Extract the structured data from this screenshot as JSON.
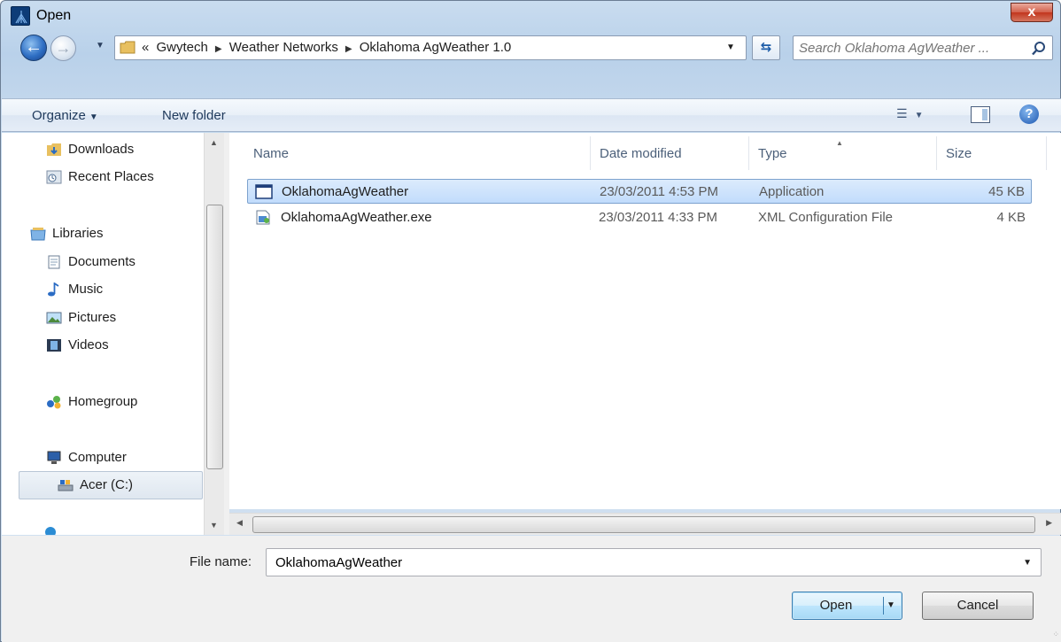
{
  "window": {
    "title": "Open",
    "close_label": "x"
  },
  "navigation": {
    "breadcrumb_prefix": "«",
    "breadcrumbs": [
      "Gwytech",
      "Weather Networks",
      "Oklahoma AgWeather 1.0"
    ],
    "search_placeholder": "Search Oklahoma AgWeather ..."
  },
  "toolbar": {
    "organize_label": "Organize",
    "new_folder_label": "New folder"
  },
  "nav_pane": {
    "items": [
      {
        "label": "Downloads",
        "icon": "downloads-folder-icon"
      },
      {
        "label": "Recent Places",
        "icon": "recent-places-icon"
      },
      {
        "label": "Libraries",
        "icon": "libraries-icon"
      },
      {
        "label": "Documents",
        "icon": "documents-icon"
      },
      {
        "label": "Music",
        "icon": "music-note-icon"
      },
      {
        "label": "Pictures",
        "icon": "pictures-icon"
      },
      {
        "label": "Videos",
        "icon": "film-icon"
      },
      {
        "label": "Homegroup",
        "icon": "homegroup-icon"
      },
      {
        "label": "Computer",
        "icon": "computer-icon"
      },
      {
        "label": "Acer (C:)",
        "icon": "drive-icon"
      }
    ]
  },
  "file_list": {
    "columns": {
      "name": "Name",
      "date_modified": "Date modified",
      "type": "Type",
      "size": "Size"
    },
    "rows": [
      {
        "name": "OklahomaAgWeather",
        "date": "23/03/2011 4:53 PM",
        "type": "Application",
        "size": "45 KB",
        "icon": "application-window-icon"
      },
      {
        "name": "OklahomaAgWeather.exe",
        "date": "23/03/2011 4:33 PM",
        "type": "XML Configuration File",
        "size": "4 KB",
        "icon": "config-file-icon"
      }
    ]
  },
  "bottom": {
    "file_name_label": "File name:",
    "file_name_value": "OklahomaAgWeather",
    "open_label": "Open",
    "cancel_label": "Cancel"
  },
  "colors": {
    "selection": "#c1dcfc",
    "frame": "#b9d1ea",
    "close_button": "#c2351d"
  }
}
